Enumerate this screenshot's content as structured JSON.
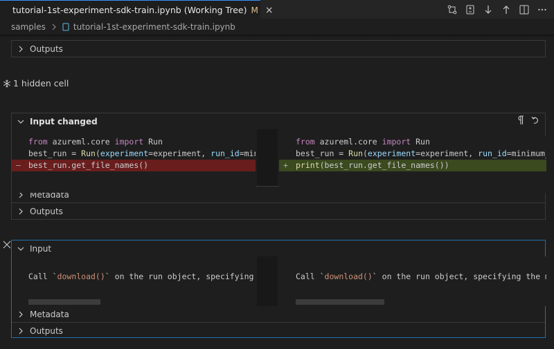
{
  "tab": {
    "title": "tutorial-1st-experiment-sdk-train.ipynb (Working Tree)",
    "modified": "M",
    "close": "×"
  },
  "breadcrumb": {
    "folder": "samples",
    "file": "tutorial-1st-experiment-sdk-train.ipynb"
  },
  "hidden": {
    "label": "1 hidden cell"
  },
  "top_panel": {
    "outputs_label": "Outputs"
  },
  "cell1": {
    "header": "Input changed",
    "left": {
      "line1": {
        "kw1": "from",
        "mod": " azureml.core ",
        "kw2": "import",
        "name": " Run"
      },
      "line2": {
        "a": "best_run = ",
        "fn": "Run",
        "b": "(",
        "param": "experiment",
        "c": "=experiment, ",
        "param2": "run_id",
        "d": "=mini"
      },
      "line3": {
        "text": "best_run.get_file_names()",
        "mark": "—"
      }
    },
    "right": {
      "line1": {
        "kw1": "from",
        "mod": " azureml.core ",
        "kw2": "import",
        "name": " Run"
      },
      "line2": {
        "a": "best_run = ",
        "fn": "Run",
        "b": "(",
        "param": "experiment",
        "c": "=experiment, ",
        "param2": "run_id",
        "d": "=minimum_r"
      },
      "line3": {
        "fn": "print",
        "text": "(best_run.get_file_names())",
        "mark": "+"
      }
    },
    "metadata_label": "Metadata",
    "outputs_label": "Outputs"
  },
  "cell2": {
    "header": "Input",
    "left": {
      "pre": "Call `",
      "code": "download()",
      "post": "` on the run object, specifying t"
    },
    "right": {
      "pre": "Call `",
      "code": "download()",
      "post": "` on the run object, specifying the mo"
    },
    "metadata_label": "Metadata",
    "outputs_label": "Outputs"
  },
  "colors": {
    "removed": "#6a1d1d",
    "added": "#3b4a1f",
    "focus_border": "#1f6fad",
    "modified": "#e2c08d"
  },
  "icons": [
    "open-changes-icon",
    "file-diff-icon",
    "arrow-down-icon",
    "arrow-up-icon",
    "split-editor-icon",
    "more-icon",
    "pilcrow-icon",
    "revert-icon",
    "chevron-right-icon",
    "chevron-down-icon",
    "snowflake-icon",
    "close-icon"
  ]
}
